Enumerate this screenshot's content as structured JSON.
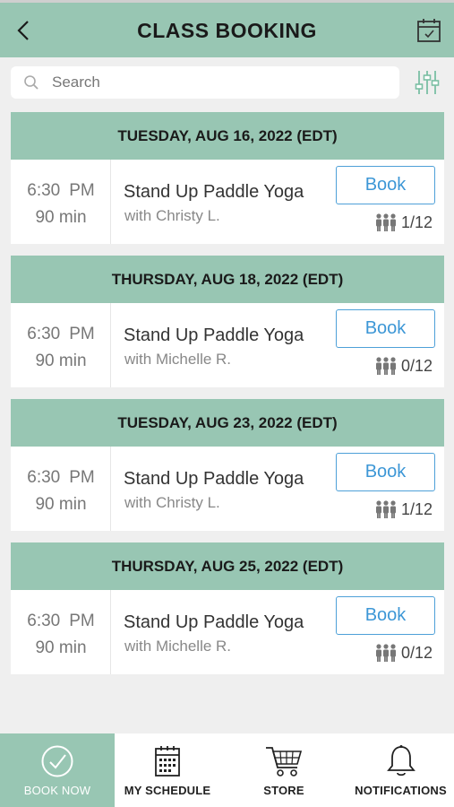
{
  "header": {
    "title": "CLASS BOOKING",
    "back_icon": "chevron-left-icon",
    "calendar_icon": "calendar-check-icon"
  },
  "search": {
    "placeholder": "Search",
    "icon": "search-icon",
    "filter_icon": "sliders-icon"
  },
  "days": [
    {
      "date": "TUESDAY, AUG 16, 2022 (EDT)",
      "class": {
        "time": "6:30",
        "ampm": "PM",
        "duration": "90 min",
        "name": "Stand Up Paddle Yoga",
        "instructor": "with Christy L.",
        "book_label": "Book",
        "capacity": "1/12"
      }
    },
    {
      "date": "THURSDAY, AUG 18, 2022 (EDT)",
      "class": {
        "time": "6:30",
        "ampm": "PM",
        "duration": "90 min",
        "name": "Stand Up Paddle Yoga",
        "instructor": "with Michelle R.",
        "book_label": "Book",
        "capacity": "0/12"
      }
    },
    {
      "date": "TUESDAY, AUG 23, 2022 (EDT)",
      "class": {
        "time": "6:30",
        "ampm": "PM",
        "duration": "90 min",
        "name": "Stand Up Paddle Yoga",
        "instructor": "with Christy L.",
        "book_label": "Book",
        "capacity": "1/12"
      }
    },
    {
      "date": "THURSDAY, AUG 25, 2022 (EDT)",
      "class": {
        "time": "6:30",
        "ampm": "PM",
        "duration": "90 min",
        "name": "Stand Up Paddle Yoga",
        "instructor": "with Michelle R.",
        "book_label": "Book",
        "capacity": "0/12"
      }
    }
  ],
  "tabbar": {
    "tabs": [
      {
        "label": "BOOK NOW",
        "icon": "check-circle-icon",
        "active": true
      },
      {
        "label": "MY SCHEDULE",
        "icon": "calendar-icon",
        "active": false
      },
      {
        "label": "STORE",
        "icon": "cart-icon",
        "active": false
      },
      {
        "label": "NOTIFICATIONS",
        "icon": "bell-icon",
        "active": false
      }
    ]
  },
  "colors": {
    "accent": "#98c6b3",
    "link_blue": "#3d97d6",
    "background": "#efefef"
  }
}
